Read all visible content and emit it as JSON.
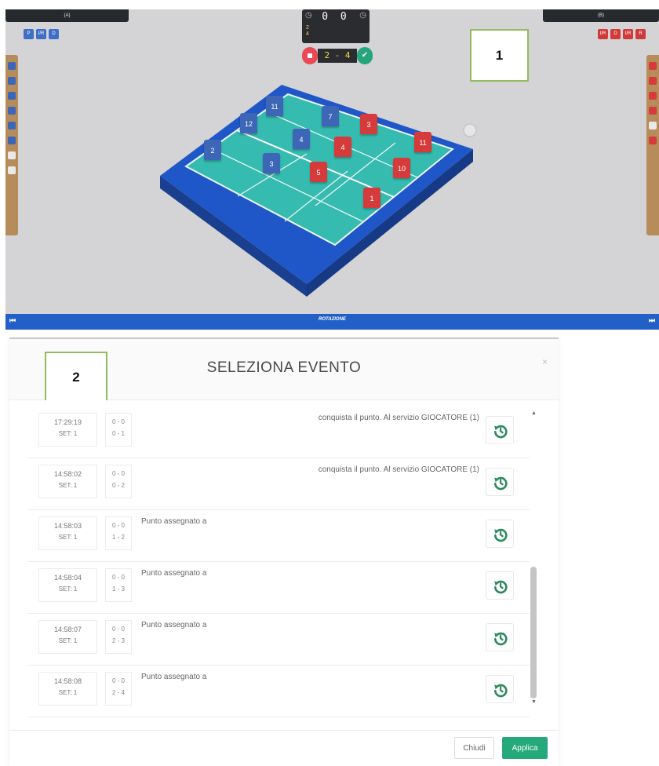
{
  "panel1": {
    "callout_label": "1",
    "left_team_label": "(A)",
    "right_team_label": "(B)",
    "left_chips": [
      "P",
      "I/R",
      "D"
    ],
    "right_chips": [
      "I/R",
      "D",
      "I/R",
      "R"
    ],
    "scoreboard": {
      "points": "0 0",
      "set_line1": "2",
      "set_line2": "4"
    },
    "score_edit": "2 - 4",
    "rotation_label": "ROTAZIONE",
    "players_blue": [
      "11",
      "7",
      "12",
      "4",
      "2",
      "3"
    ],
    "players_red": [
      "3",
      "4",
      "5",
      "11",
      "10",
      "1"
    ],
    "colors": {
      "blue_team": "#3d67b6",
      "red_team": "#d53b3b",
      "court": "#34b9ae",
      "apron": "#1f57c8"
    }
  },
  "panel2": {
    "callout_label": "2",
    "title": "SELEZIONA EVENTO",
    "close_icon": "×",
    "events": [
      {
        "time": "17:29:19",
        "set": "SET: 1",
        "sets_score": "0 - 0",
        "points_score": "0 - 1",
        "description": "conquista il punto. Al servizio GIOCATORE (1)",
        "align": "right"
      },
      {
        "time": "14:58:02",
        "set": "SET: 1",
        "sets_score": "0 - 0",
        "points_score": "0 - 2",
        "description": "conquista il punto. Al servizio GIOCATORE (1)",
        "align": "right"
      },
      {
        "time": "14:58:03",
        "set": "SET: 1",
        "sets_score": "0 - 0",
        "points_score": "1 - 2",
        "description": "Punto assegnato a",
        "align": "left"
      },
      {
        "time": "14:58:04",
        "set": "SET: 1",
        "sets_score": "0 - 0",
        "points_score": "1 - 3",
        "description": "Punto assegnato a",
        "align": "left"
      },
      {
        "time": "14:58:07",
        "set": "SET: 1",
        "sets_score": "0 - 0",
        "points_score": "2 - 3",
        "description": "Punto assegnato a",
        "align": "left"
      },
      {
        "time": "14:58:08",
        "set": "SET: 1",
        "sets_score": "0 - 0",
        "points_score": "2 - 4",
        "description": "Punto assegnato a",
        "align": "left"
      }
    ],
    "buttons": {
      "close": "Chiudi",
      "apply": "Applica"
    },
    "colors": {
      "undo_icon": "#2a8a5c",
      "apply_button": "#25a97a"
    }
  }
}
